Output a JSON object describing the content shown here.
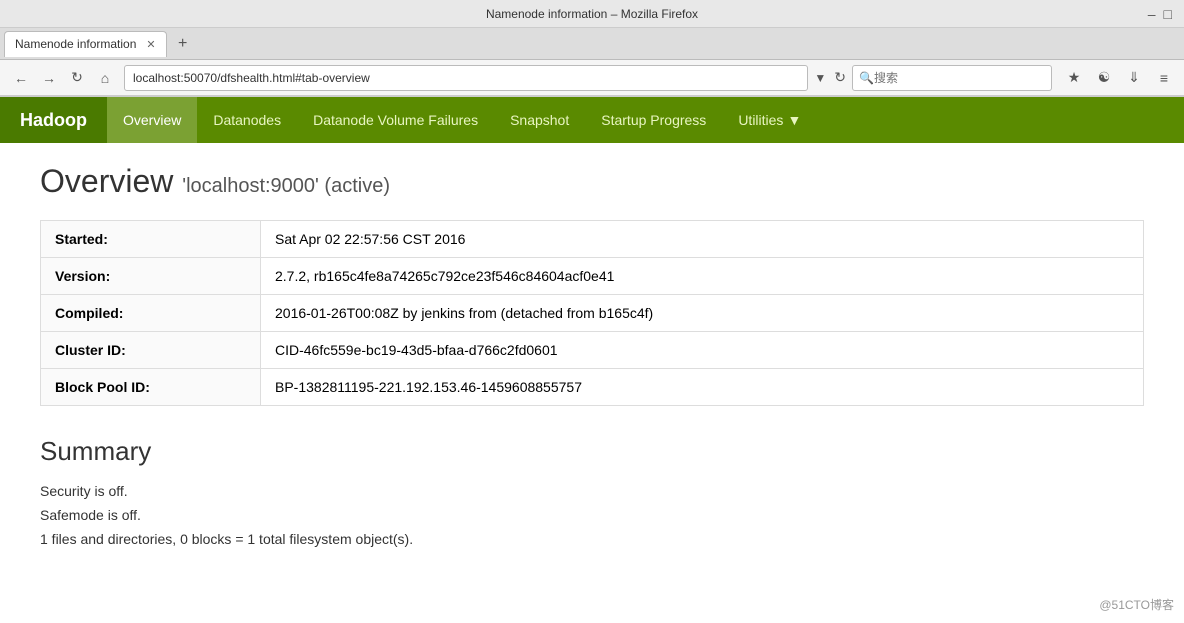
{
  "browser": {
    "title": "Namenode information – Mozilla Firefox",
    "tab_label": "Namenode information",
    "url": "localhost:50070/dfshealth.html#tab-overview",
    "search_placeholder": "搜索"
  },
  "nav": {
    "logo": "Hadoop",
    "items": [
      {
        "label": "Overview",
        "active": true
      },
      {
        "label": "Datanodes",
        "active": false
      },
      {
        "label": "Datanode Volume Failures",
        "active": false
      },
      {
        "label": "Snapshot",
        "active": false
      },
      {
        "label": "Startup Progress",
        "active": false
      },
      {
        "label": "Utilities",
        "active": false,
        "dropdown": true
      }
    ]
  },
  "overview": {
    "title": "Overview",
    "subtitle": "'localhost:9000' (active)",
    "table": [
      {
        "label": "Started:",
        "value": "Sat Apr 02 22:57:56 CST 2016"
      },
      {
        "label": "Version:",
        "value": "2.7.2, rb165c4fe8a74265c792ce23f546c84604acf0e41"
      },
      {
        "label": "Compiled:",
        "value": "2016-01-26T00:08Z by jenkins from (detached from b165c4f)"
      },
      {
        "label": "Cluster ID:",
        "value": "CID-46fc559e-bc19-43d5-bfaa-d766c2fd0601"
      },
      {
        "label": "Block Pool ID:",
        "value": "BP-1382811195-221.192.153.46-1459608855757"
      }
    ]
  },
  "summary": {
    "title": "Summary",
    "lines": [
      "Security is off.",
      "Safemode is off.",
      "1 files and directories, 0 blocks = 1 total filesystem object(s)."
    ]
  },
  "watermark": "@51CTO博客"
}
